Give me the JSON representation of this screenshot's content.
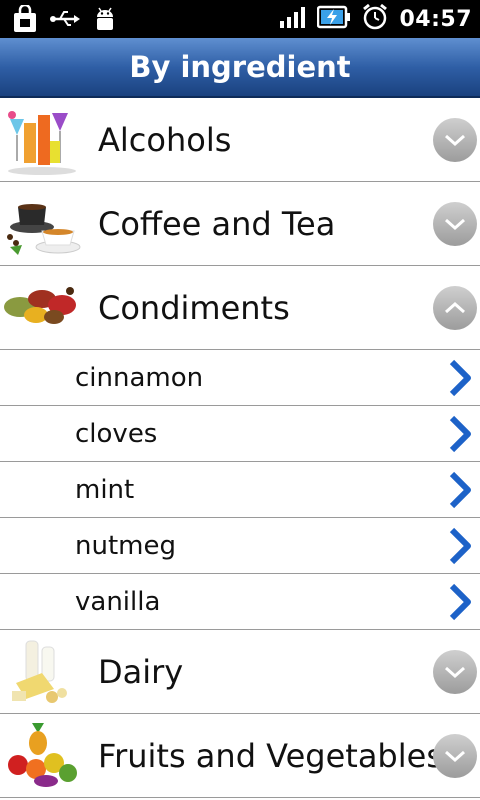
{
  "status_bar": {
    "time": "04:57",
    "icons": [
      "shopping-bag-icon",
      "usb-icon",
      "android-debug-icon",
      "signal-icon",
      "battery-charging-icon",
      "alarm-clock-icon"
    ]
  },
  "title": "By ingredient",
  "categories": [
    {
      "label": "Alcohols",
      "expanded": false,
      "thumb_icon": "cocktail-glasses-icon"
    },
    {
      "label": "Coffee and Tea",
      "expanded": false,
      "thumb_icon": "coffee-cup-icon"
    },
    {
      "label": "Condiments",
      "expanded": true,
      "thumb_icon": "spices-icon",
      "items": [
        "cinnamon",
        "cloves",
        "mint",
        "nutmeg",
        "vanilla"
      ]
    },
    {
      "label": "Dairy",
      "expanded": false,
      "thumb_icon": "dairy-icon"
    },
    {
      "label": "Fruits and Vegetables",
      "expanded": false,
      "thumb_icon": "fruits-vegetables-icon"
    }
  ],
  "colors": {
    "title_bar": "#2f5fa6",
    "arrow": "#1d62c8",
    "toggle": "#b0b0b0"
  }
}
